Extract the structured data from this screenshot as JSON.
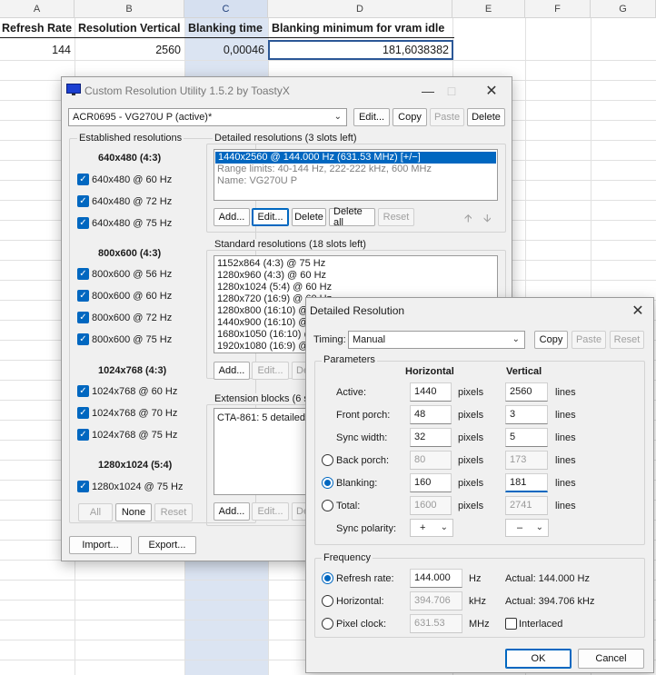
{
  "sheet": {
    "columns": [
      "A",
      "B",
      "C",
      "D",
      "E",
      "F",
      "G"
    ],
    "headers": [
      "Refresh Rate",
      "Resolution Vertical",
      "Blanking time",
      "Blanking minimum for vram idle"
    ],
    "row": [
      "144",
      "2560",
      "0,00046",
      "181,6038382"
    ]
  },
  "cru": {
    "title": "Custom Resolution Utility 1.5.2 by ToastyX",
    "monitor": "ACR0695 - VG270U P (active)*",
    "top_buttons": {
      "edit": "Edit...",
      "copy": "Copy",
      "paste": "Paste",
      "delete": "Delete"
    },
    "established": {
      "title": "Established resolutions",
      "groups": [
        {
          "heading": "640x480 (4:3)",
          "items": [
            "640x480 @ 60 Hz",
            "640x480 @ 72 Hz",
            "640x480 @ 75 Hz"
          ]
        },
        {
          "heading": "800x600 (4:3)",
          "items": [
            "800x600 @ 56 Hz",
            "800x600 @ 60 Hz",
            "800x600 @ 72 Hz",
            "800x600 @ 75 Hz"
          ]
        },
        {
          "heading": "1024x768 (4:3)",
          "items": [
            "1024x768 @ 60 Hz",
            "1024x768 @ 70 Hz",
            "1024x768 @ 75 Hz"
          ]
        },
        {
          "heading": "1280x1024 (5:4)",
          "items": [
            "1280x1024 @ 75 Hz"
          ]
        }
      ],
      "buttons": {
        "all": "All",
        "none": "None",
        "reset": "Reset"
      }
    },
    "detailed": {
      "title": "Detailed resolutions (3 slots left)",
      "selected": "1440x2560 @ 144.000 Hz (631.53 MHz) [+/−]",
      "range": "Range limits: 40-144 Hz, 222-222 kHz, 600 MHz",
      "name": "Name: VG270U P",
      "buttons": {
        "add": "Add...",
        "edit": "Edit...",
        "delete": "Delete",
        "delete_all": "Delete all",
        "reset": "Reset"
      }
    },
    "standard": {
      "title": "Standard resolutions (18 slots left)",
      "items": [
        "1152x864 (4:3) @ 75 Hz",
        "1280x960 (4:3) @ 60 Hz",
        "1280x1024 (5:4) @ 60 Hz",
        "1280x720 (16:9) @ 60 Hz",
        "1280x800 (16:10) @ 60 Hz",
        "1440x900 (16:10) @ 60 Hz",
        "1680x1050 (16:10) @ 60 Hz",
        "1920x1080 (16:9) @ 60 Hz"
      ],
      "buttons": {
        "add": "Add...",
        "edit": "Edit...",
        "delete": "De"
      }
    },
    "extension": {
      "title": "Extension blocks (6 s",
      "items": [
        "CTA-861: 5 detailed"
      ],
      "buttons": {
        "add": "Add...",
        "edit": "Edit...",
        "delete": "De"
      }
    },
    "bottom_buttons": {
      "import": "Import...",
      "export": "Export..."
    }
  },
  "dr": {
    "title": "Detailed Resolution",
    "timing_label": "Timing:",
    "timing_value": "Manual",
    "buttons": {
      "copy": "Copy",
      "paste": "Paste",
      "reset": "Reset"
    },
    "parameters": {
      "title": "Parameters",
      "col_h": "Horizontal",
      "col_v": "Vertical",
      "rows": [
        {
          "label": "Active:",
          "h": "1440",
          "h_unit": "pixels",
          "v": "2560",
          "v_unit": "lines"
        },
        {
          "label": "Front porch:",
          "h": "48",
          "h_unit": "pixels",
          "v": "3",
          "v_unit": "lines"
        },
        {
          "label": "Sync width:",
          "h": "32",
          "h_unit": "pixels",
          "v": "5",
          "v_unit": "lines"
        },
        {
          "label": "Back porch:",
          "h": "80",
          "h_unit": "pixels",
          "v": "173",
          "v_unit": "lines"
        },
        {
          "label": "Blanking:",
          "h": "160",
          "h_unit": "pixels",
          "v": "181",
          "v_unit": "lines"
        },
        {
          "label": "Total:",
          "h": "1600",
          "h_unit": "pixels",
          "v": "2741",
          "v_unit": "lines"
        }
      ],
      "sync_label": "Sync polarity:",
      "sync_h": "+",
      "sync_v": "–"
    },
    "frequency": {
      "title": "Frequency",
      "refresh_label": "Refresh rate:",
      "refresh_value": "144.000",
      "refresh_unit": "Hz",
      "refresh_actual": "Actual: 144.000 Hz",
      "horizontal_label": "Horizontal:",
      "horizontal_value": "394.706",
      "horizontal_unit": "kHz",
      "horizontal_actual": "Actual: 394.706 kHz",
      "pixel_label": "Pixel clock:",
      "pixel_value": "631.53",
      "pixel_unit": "MHz",
      "interlaced_label": "Interlaced"
    },
    "ok": "OK",
    "cancel": "Cancel"
  }
}
